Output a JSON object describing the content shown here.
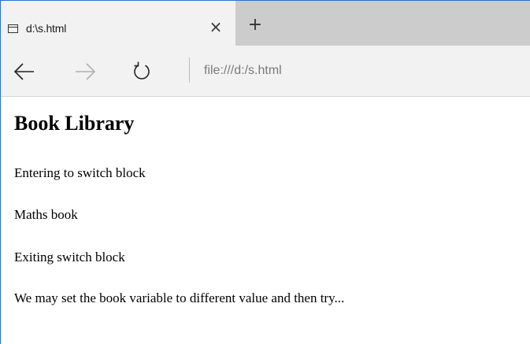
{
  "browser": {
    "tab": {
      "title": "d:\\s.html",
      "icon": "page-icon",
      "close_icon": "close-icon"
    },
    "new_tab_icon": "plus-icon",
    "nav": {
      "back_icon": "arrow-left-icon",
      "forward_icon": "arrow-right-icon",
      "refresh_icon": "refresh-icon"
    },
    "address": "file:///d:/s.html"
  },
  "page": {
    "heading": "Book Library",
    "paragraphs": [
      "Entering to switch block",
      "Maths book",
      "Exiting switch block",
      "We may set the book variable to different value and then try..."
    ]
  },
  "colors": {
    "window_border": "#2b6fd6",
    "tab_active_bg": "#f2f2f2",
    "tabstrip_bg": "#cccccc",
    "address_text": "#7a7a7a"
  }
}
